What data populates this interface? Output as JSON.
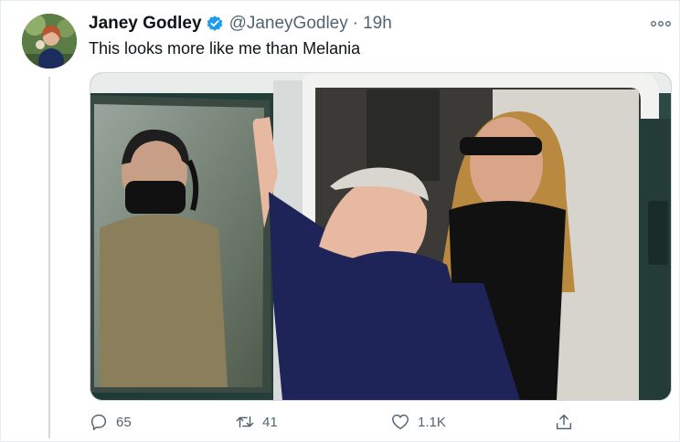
{
  "tweet": {
    "display_name": "Janey Godley",
    "handle": "@JaneyGodley",
    "separator": "·",
    "time": "19h",
    "text": "This looks more like me than Melania"
  },
  "icons": {
    "verified": "verified-badge-icon",
    "more": "more-options-icon",
    "reply": "reply-icon",
    "retweet": "retweet-icon",
    "like": "like-icon",
    "share": "share-icon"
  },
  "actions": {
    "reply_count": "65",
    "retweet_count": "41",
    "like_count": "1.1K"
  },
  "colors": {
    "verified": "#1d9bf0",
    "secondary_text": "#536471",
    "thread_line": "#cfd9de"
  }
}
